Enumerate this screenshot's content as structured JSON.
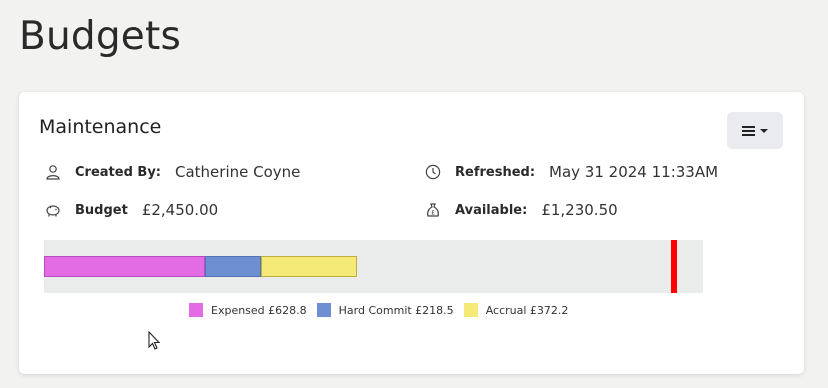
{
  "page": {
    "title": "Budgets"
  },
  "card": {
    "title": "Maintenance",
    "created_by": {
      "label": "Created By:",
      "value": "Catherine Coyne",
      "icon": "user-icon"
    },
    "refreshed": {
      "label": "Refreshed:",
      "value": "May 31 2024 11:33AM",
      "icon": "clock-icon"
    },
    "budget": {
      "label": "Budget",
      "value": "£2,450.00",
      "icon": "piggy-bank-icon"
    },
    "available": {
      "label": "Available:",
      "value": "£1,230.50",
      "icon": "money-bag-icon"
    }
  },
  "chart_data": {
    "type": "bar",
    "orientation": "horizontal-stacked",
    "total_budget": 2450.0,
    "series": [
      {
        "name": "Expensed",
        "value": 628.8,
        "color": "#e36be3"
      },
      {
        "name": "Hard Commit",
        "value": 218.5,
        "color": "#6d8fd1"
      },
      {
        "name": "Accrual",
        "value": 372.2,
        "color": "#f5ea78"
      }
    ],
    "legend": [
      "Expensed £628.8",
      "Hard Commit £218.5",
      "Accrual £372.2"
    ],
    "limit_marker_color": "#ff0000"
  }
}
